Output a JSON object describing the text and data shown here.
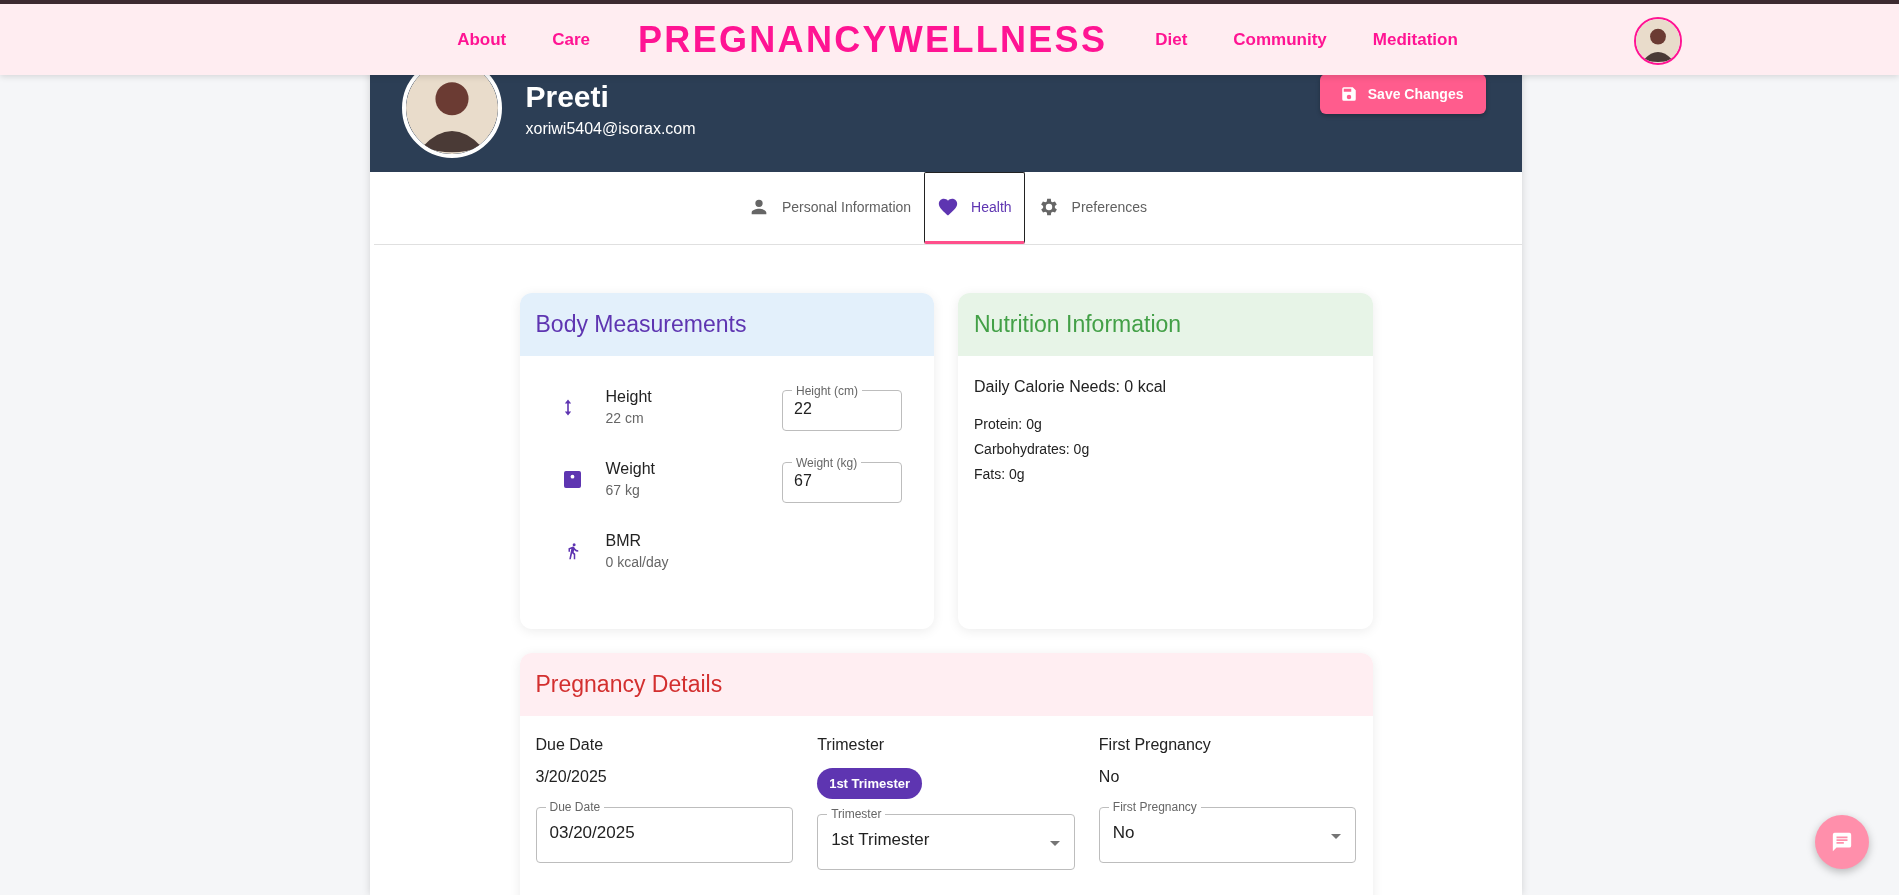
{
  "navbar": {
    "links_left": [
      {
        "label": "About"
      },
      {
        "label": "Care"
      }
    ],
    "brand": "PREGNANCYWELLNESS",
    "links_right": [
      {
        "label": "Diet"
      },
      {
        "label": "Community"
      },
      {
        "label": "Meditation"
      }
    ]
  },
  "profile": {
    "name": "Preeti",
    "email": "xoriwi5404@isorax.com",
    "save_button": "Save Changes"
  },
  "tabs": [
    {
      "label": "Personal Information",
      "selected": false
    },
    {
      "label": "Health",
      "selected": true
    },
    {
      "label": "Preferences",
      "selected": false
    }
  ],
  "body_measurements": {
    "title": "Body Measurements",
    "rows": [
      {
        "label": "Height",
        "value": "22 cm",
        "field": {
          "label": "Height (cm)",
          "value": "22"
        }
      },
      {
        "label": "Weight",
        "value": "67 kg",
        "field": {
          "label": "Weight (kg)",
          "value": "67"
        }
      },
      {
        "label": "BMR",
        "value": "0 kcal/day"
      }
    ]
  },
  "nutrition": {
    "title": "Nutrition Information",
    "calories": "Daily Calorie Needs: 0 kcal",
    "macros": [
      "Protein: 0g",
      "Carbohydrates: 0g",
      "Fats: 0g"
    ]
  },
  "pregnancy": {
    "title": "Pregnancy Details",
    "columns": [
      {
        "kind": "plain",
        "label": "Due Date",
        "value": "3/20/2025",
        "field": {
          "kind": "input",
          "label": "Due Date",
          "value": "03/20/2025"
        }
      },
      {
        "kind": "chip",
        "label": "Trimester",
        "value": "1st Trimester",
        "field": {
          "kind": "select",
          "label": "Trimester",
          "value": "1st Trimester"
        }
      },
      {
        "kind": "plain",
        "label": "First Pregnancy",
        "value": "No",
        "field": {
          "kind": "select",
          "label": "First Pregnancy",
          "value": "No"
        }
      }
    ]
  }
}
